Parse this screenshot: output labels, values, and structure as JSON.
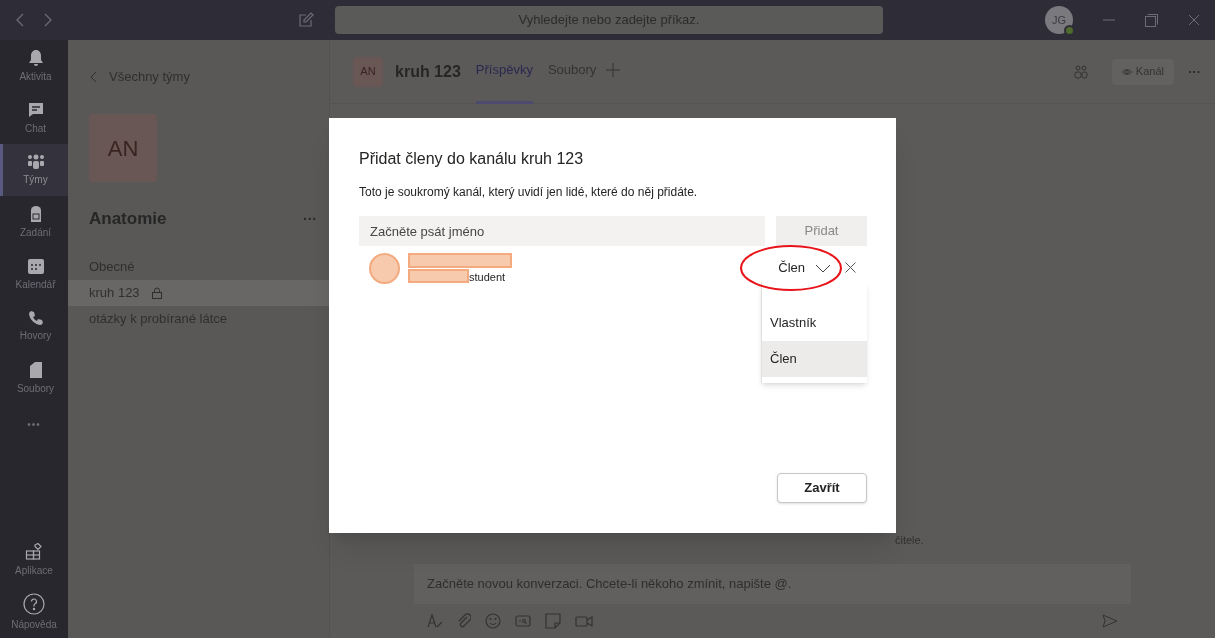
{
  "title_bar": {
    "search_placeholder": "Vyhledejte nebo zadejte příkaz.",
    "avatar_initials": "JG"
  },
  "rail": {
    "items": [
      {
        "label": "Aktivita",
        "kind": "bell",
        "selected": false
      },
      {
        "label": "Chat",
        "kind": "chat",
        "selected": false
      },
      {
        "label": "Týmy",
        "kind": "teams",
        "selected": true
      },
      {
        "label": "Zadání",
        "kind": "bag",
        "selected": false
      },
      {
        "label": "Kalendář",
        "kind": "calendar",
        "selected": false
      },
      {
        "label": "Hovory",
        "kind": "phone",
        "selected": false
      },
      {
        "label": "Soubory",
        "kind": "file",
        "selected": false
      }
    ],
    "more": "•••",
    "bottom_items": [
      {
        "label": "Aplikace",
        "kind": "apps"
      },
      {
        "label": "Nápověda",
        "kind": "help"
      }
    ]
  },
  "team_panel": {
    "back_link": "Všechny týmy",
    "avatar": "AN",
    "name": "Anatomie",
    "more": "···",
    "channels": [
      {
        "name": "Obecné",
        "selected": false,
        "locked": false
      },
      {
        "name": "kruh 123",
        "selected": true,
        "locked": true
      },
      {
        "name": "otázky k probírané látce",
        "selected": false,
        "locked": false
      }
    ]
  },
  "channel_header": {
    "avatar": "AN",
    "name": "kruh 123",
    "tabs": [
      {
        "label": "Příspěvky",
        "selected": true
      },
      {
        "label": "Soubory",
        "selected": false
      }
    ],
    "view_button": "Kanál",
    "more": "···"
  },
  "main": {
    "partial_text": "čitele.",
    "compose_placeholder": "Začněte novou konverzaci. Chcete-li někoho zmínit, napište @."
  },
  "dialog": {
    "title": "Přidat členy do kanálu kruh 123",
    "description": "Toto je soukromý kanál, který uvidí jen lidé, které do něj přidáte.",
    "name_placeholder": "Začněte psát jméno",
    "add_button": {
      "label": "Přidat",
      "disabled": true
    },
    "member": {
      "name_redacted": true,
      "subtitle": "student",
      "role": "Člen"
    },
    "role_menu": {
      "options": [
        {
          "label": "Vlastník",
          "selected": false
        },
        {
          "label": "Člen",
          "selected": true
        }
      ]
    },
    "highlight_role": true,
    "close_button": "Zavřít"
  }
}
